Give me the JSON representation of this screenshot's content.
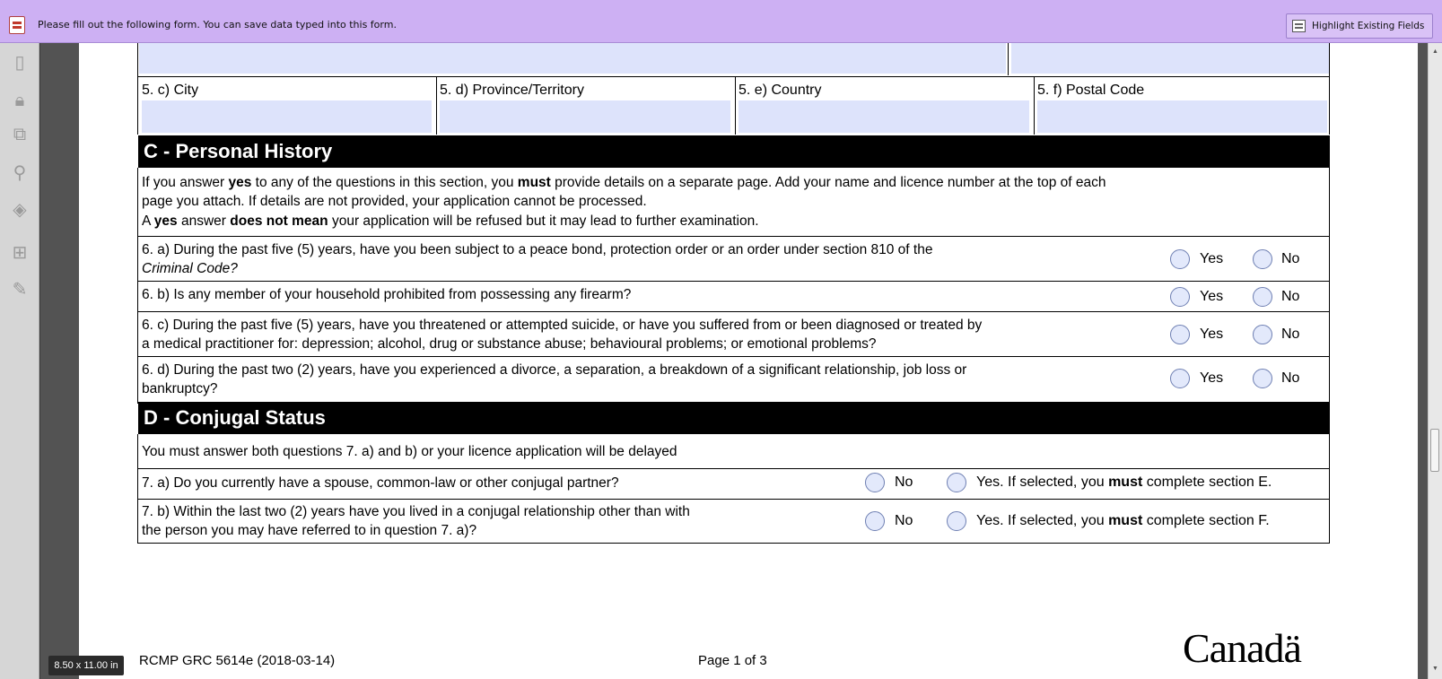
{
  "topbar": {
    "message": "Please fill out the following form. You can save data typed into this form.",
    "highlight_button": "Highlight Existing Fields"
  },
  "section_5": {
    "city_label": "5. c) City",
    "province_label": "5. d) Province/Territory",
    "country_label": "5. e) Country",
    "postal_label": "5. f) Postal Code"
  },
  "section_c": {
    "title": "C - Personal History",
    "intro_line1_a": "If you answer ",
    "intro_line1_b": "yes",
    "intro_line1_c": " to any of the questions in this section, you ",
    "intro_line1_d": "must",
    "intro_line1_e": " provide details on a separate page. Add your name and licence number at the top of each",
    "intro_line2": "page you attach. If details are not provided, your application cannot be processed.",
    "intro_line3_a": "A ",
    "intro_line3_b": "yes",
    "intro_line3_c": " answer ",
    "intro_line3_d": "does not mean",
    "intro_line3_e": " your application will be refused but it may lead to further examination.",
    "q6a_line1": "6. a) During the past five (5) years, have you been subject to a peace bond, protection order or an order under section 810 of the",
    "q6a_line2": "Criminal Code?",
    "q6b": "6. b) Is any member of your household prohibited from possessing any firearm?",
    "q6c_line1": "6. c) During the past five (5) years, have you threatened or attempted suicide, or have you suffered from or been diagnosed or treated by",
    "q6c_line2": "a medical practitioner for: depression; alcohol, drug or substance abuse; behavioural problems; or emotional problems?",
    "q6d_line1": "6. d) During the past two (2) years, have you experienced a divorce, a separation, a breakdown of a significant relationship, job loss or",
    "q6d_line2": "bankruptcy?",
    "yes": "Yes",
    "no": "No"
  },
  "section_d": {
    "title": "D - Conjugal Status",
    "intro": "You must answer both questions 7. a) and b) or your licence application will be delayed",
    "q7a": "7. a) Do you currently have a spouse, common-law or other conjugal partner?",
    "q7b_line1": "7. b) Within the last two (2) years have you lived in a conjugal relationship other than with",
    "q7b_line2": "the person you may have referred to in question 7. a)?",
    "no": "No",
    "yes_e_a": "Yes. If selected, you ",
    "yes_e_b": "must",
    "yes_e_c": " complete section E.",
    "yes_f_a": "Yes. If selected, you ",
    "yes_f_b": "must",
    "yes_f_c": " complete section F."
  },
  "footer": {
    "form_id": "RCMP GRC 5614e (2018-03-14)",
    "page": "Page 1 of 3",
    "wordmark": "Canadä",
    "page_size": "8.50 x 11.00 in"
  },
  "icons": [
    "pages-icon",
    "lock-icon",
    "copy-icon",
    "attachment-icon",
    "layers-icon",
    "binoculars-icon",
    "signature-icon"
  ]
}
